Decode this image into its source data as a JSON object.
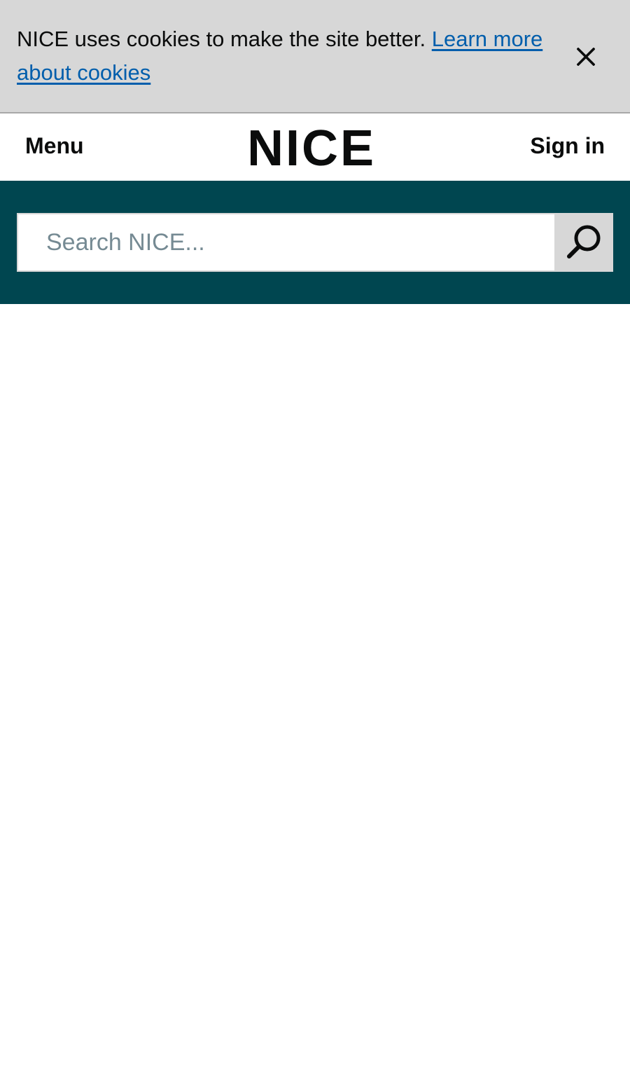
{
  "cookie_banner": {
    "message": "NICE uses cookies to make the site better. ",
    "link_text": "Learn more about cookies",
    "close_icon": "close-icon"
  },
  "header": {
    "menu_label": "Menu",
    "logo_text": "NICE",
    "signin_label": "Sign in"
  },
  "search": {
    "placeholder": "Search NICE...",
    "value": "",
    "button_icon": "search-icon"
  },
  "colors": {
    "banner_background": "#d7d7d7",
    "link": "#005eac",
    "brand_band": "#004650",
    "search_button": "#d7d7d7",
    "placeholder": "#758a93"
  }
}
